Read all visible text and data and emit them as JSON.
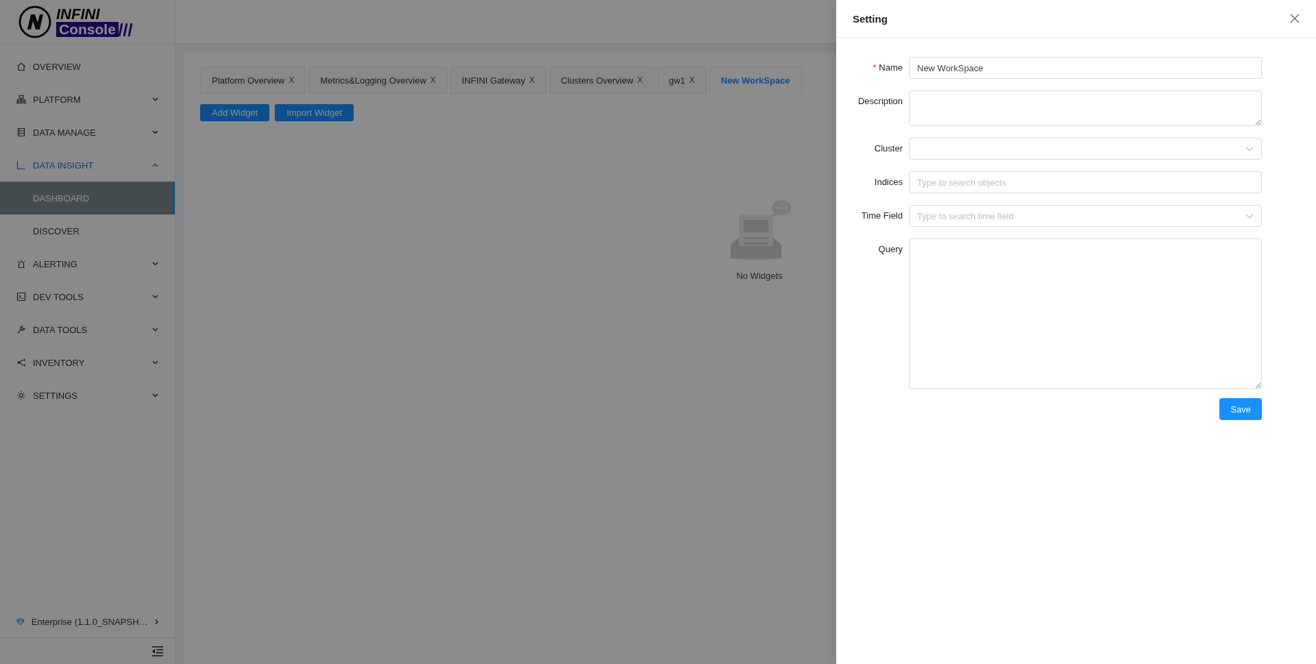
{
  "logo": {
    "line_1": "INFINI",
    "line_2": "Console"
  },
  "sidebar": {
    "items": [
      {
        "label": "OVERVIEW",
        "kind": "item",
        "selected": false
      },
      {
        "label": "PLATFORM",
        "kind": "group",
        "expanded": false
      },
      {
        "label": "DATA MANAGE",
        "kind": "group",
        "expanded": false
      },
      {
        "label": "DATA INSIGHT",
        "kind": "group",
        "expanded": true,
        "children": [
          {
            "label": "DASHBOARD",
            "selected": true
          },
          {
            "label": "DISCOVER",
            "selected": false
          }
        ]
      },
      {
        "label": "ALERTING",
        "kind": "group",
        "expanded": false
      },
      {
        "label": "DEV TOOLS",
        "kind": "group",
        "expanded": false
      },
      {
        "label": "DATA TOOLS",
        "kind": "group",
        "expanded": false
      },
      {
        "label": "INVENTORY",
        "kind": "group",
        "expanded": false
      },
      {
        "label": "SETTINGS",
        "kind": "group",
        "expanded": false
      }
    ],
    "footer": "Enterprise (1.1.0_SNAPSH…"
  },
  "tabs": [
    {
      "label": "Platform Overview",
      "close": "X",
      "selected": false
    },
    {
      "label": "Metrics&Logging Overview",
      "close": "X",
      "selected": false
    },
    {
      "label": "INFINI Gateway",
      "close": "X",
      "selected": false
    },
    {
      "label": "Clusters Overview",
      "close": "X",
      "selected": false
    },
    {
      "label": "gw1",
      "close": "X",
      "selected": false
    },
    {
      "label": "New WorkSpace",
      "selected": true
    }
  ],
  "buttons": [
    "Add Widget",
    "Import Widget"
  ],
  "empty_state": "No Widgets",
  "drawer": {
    "title": "Setting",
    "fields": [
      {
        "label": "Name",
        "kind": "input",
        "required_mark": "*",
        "value": "New WorkSpace"
      },
      {
        "label": "Description",
        "kind": "textarea"
      },
      {
        "label": "Cluster",
        "kind": "select"
      },
      {
        "label": "Indices",
        "kind": "input",
        "placeholder": "Type to search objects"
      },
      {
        "label": "Time Field",
        "kind": "select",
        "placeholder": "Type to search time field"
      },
      {
        "label": "Query",
        "kind": "editor"
      }
    ],
    "submit": "Save"
  }
}
